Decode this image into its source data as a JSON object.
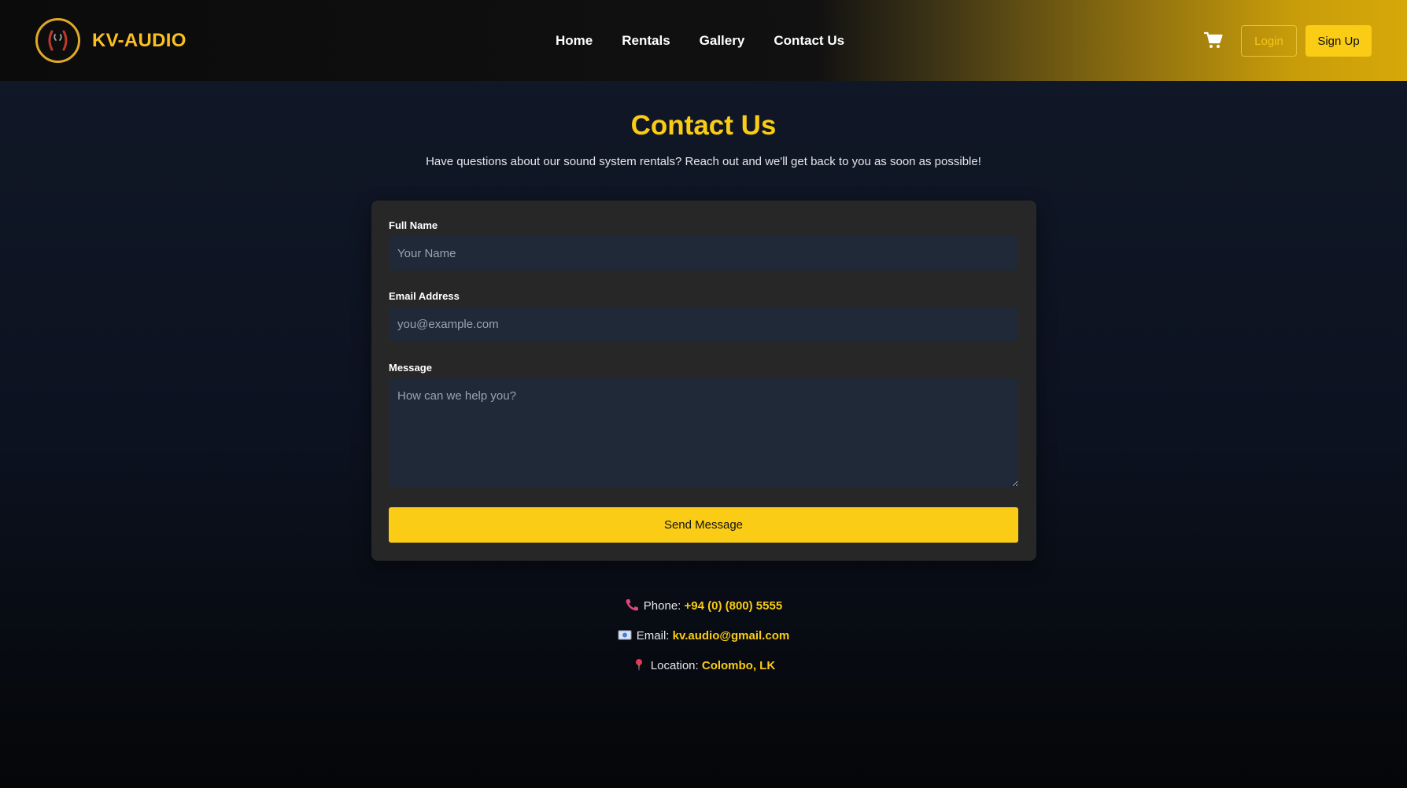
{
  "brand": {
    "name": "KV-AUDIO",
    "accent": "#facc15"
  },
  "nav": {
    "home": "Home",
    "rentals": "Rentals",
    "gallery": "Gallery",
    "contact": "Contact Us"
  },
  "header": {
    "cart_icon": "cart-icon",
    "login_label": "Login",
    "signup_label": "Sign Up"
  },
  "page": {
    "title": "Contact Us",
    "subtitle": "Have questions about our sound system rentals? Reach out and we'll get back to you as soon as possible!"
  },
  "form": {
    "name_label": "Full Name",
    "name_placeholder": "Your Name",
    "email_label": "Email Address",
    "email_placeholder": "you@example.com",
    "message_label": "Message",
    "message_placeholder": "How can we help you?",
    "submit_label": "Send Message"
  },
  "contact_info": {
    "phone_label": "Phone:",
    "phone_value": "+94 (0) (800) 5555",
    "email_label": "Email:",
    "email_value": "kv.audio@gmail.com",
    "location_label": "Location:",
    "location_value": "Colombo, LK"
  },
  "colors": {
    "accent": "#facc15",
    "background": "#111827",
    "card": "#272727",
    "input": "#1f2937"
  }
}
